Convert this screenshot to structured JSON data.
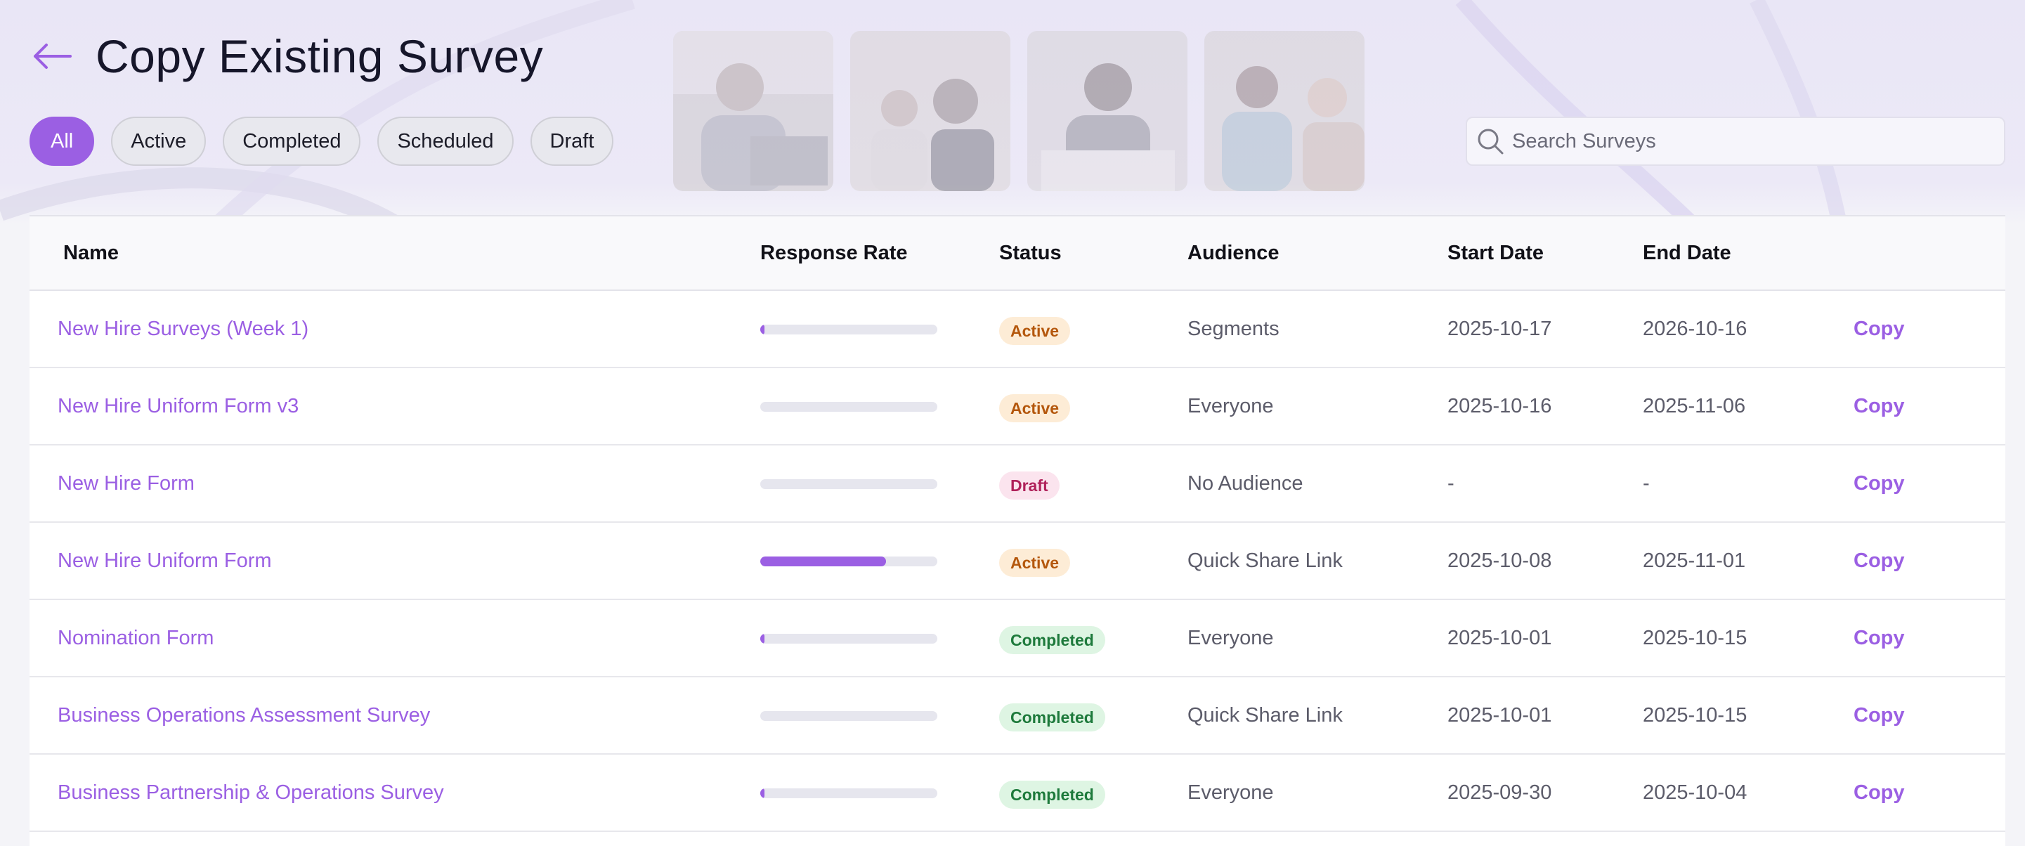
{
  "header": {
    "back_icon": "arrow-left-icon",
    "title": "Copy Existing Survey"
  },
  "filters": [
    {
      "label": "All",
      "active": true
    },
    {
      "label": "Active",
      "active": false
    },
    {
      "label": "Completed",
      "active": false
    },
    {
      "label": "Scheduled",
      "active": false
    },
    {
      "label": "Draft",
      "active": false
    }
  ],
  "search": {
    "icon": "search-icon",
    "placeholder": "Search Surveys",
    "value": ""
  },
  "table": {
    "columns": {
      "name": "Name",
      "response_rate": "Response Rate",
      "status": "Status",
      "audience": "Audience",
      "start_date": "Start Date",
      "end_date": "End Date"
    },
    "rows": [
      {
        "name": "New Hire Surveys (Week 1)",
        "response_rate": 0.02,
        "status": "Active",
        "audience": "Segments",
        "start_date": "2025-10-17",
        "end_date": "2026-10-16",
        "action": "Copy"
      },
      {
        "name": "New Hire Uniform Form v3",
        "response_rate": 0.0,
        "status": "Active",
        "audience": "Everyone",
        "start_date": "2025-10-16",
        "end_date": "2025-11-06",
        "action": "Copy"
      },
      {
        "name": "New Hire Form",
        "response_rate": 0.0,
        "status": "Draft",
        "audience": "No Audience",
        "start_date": "-",
        "end_date": "-",
        "action": "Copy"
      },
      {
        "name": "New Hire Uniform Form",
        "response_rate": 0.71,
        "status": "Active",
        "audience": "Quick Share Link",
        "start_date": "2025-10-08",
        "end_date": "2025-11-01",
        "action": "Copy"
      },
      {
        "name": "Nomination Form",
        "response_rate": 0.02,
        "status": "Completed",
        "audience": "Everyone",
        "start_date": "2025-10-01",
        "end_date": "2025-10-15",
        "action": "Copy"
      },
      {
        "name": "Business Operations Assessment Survey",
        "response_rate": 0.0,
        "status": "Completed",
        "audience": "Quick Share Link",
        "start_date": "2025-10-01",
        "end_date": "2025-10-15",
        "action": "Copy"
      },
      {
        "name": "Business Partnership & Operations Survey",
        "response_rate": 0.02,
        "status": "Completed",
        "audience": "Everyone",
        "start_date": "2025-09-30",
        "end_date": "2025-10-04",
        "action": "Copy"
      }
    ]
  },
  "colors": {
    "accent": "#9b5fe3",
    "status_active_bg": "#fdecd6",
    "status_active_fg": "#b4570c",
    "status_draft_bg": "#fbe4ee",
    "status_draft_fg": "#b0215a",
    "status_completed_bg": "#def5e3",
    "status_completed_fg": "#1e7a3c"
  }
}
